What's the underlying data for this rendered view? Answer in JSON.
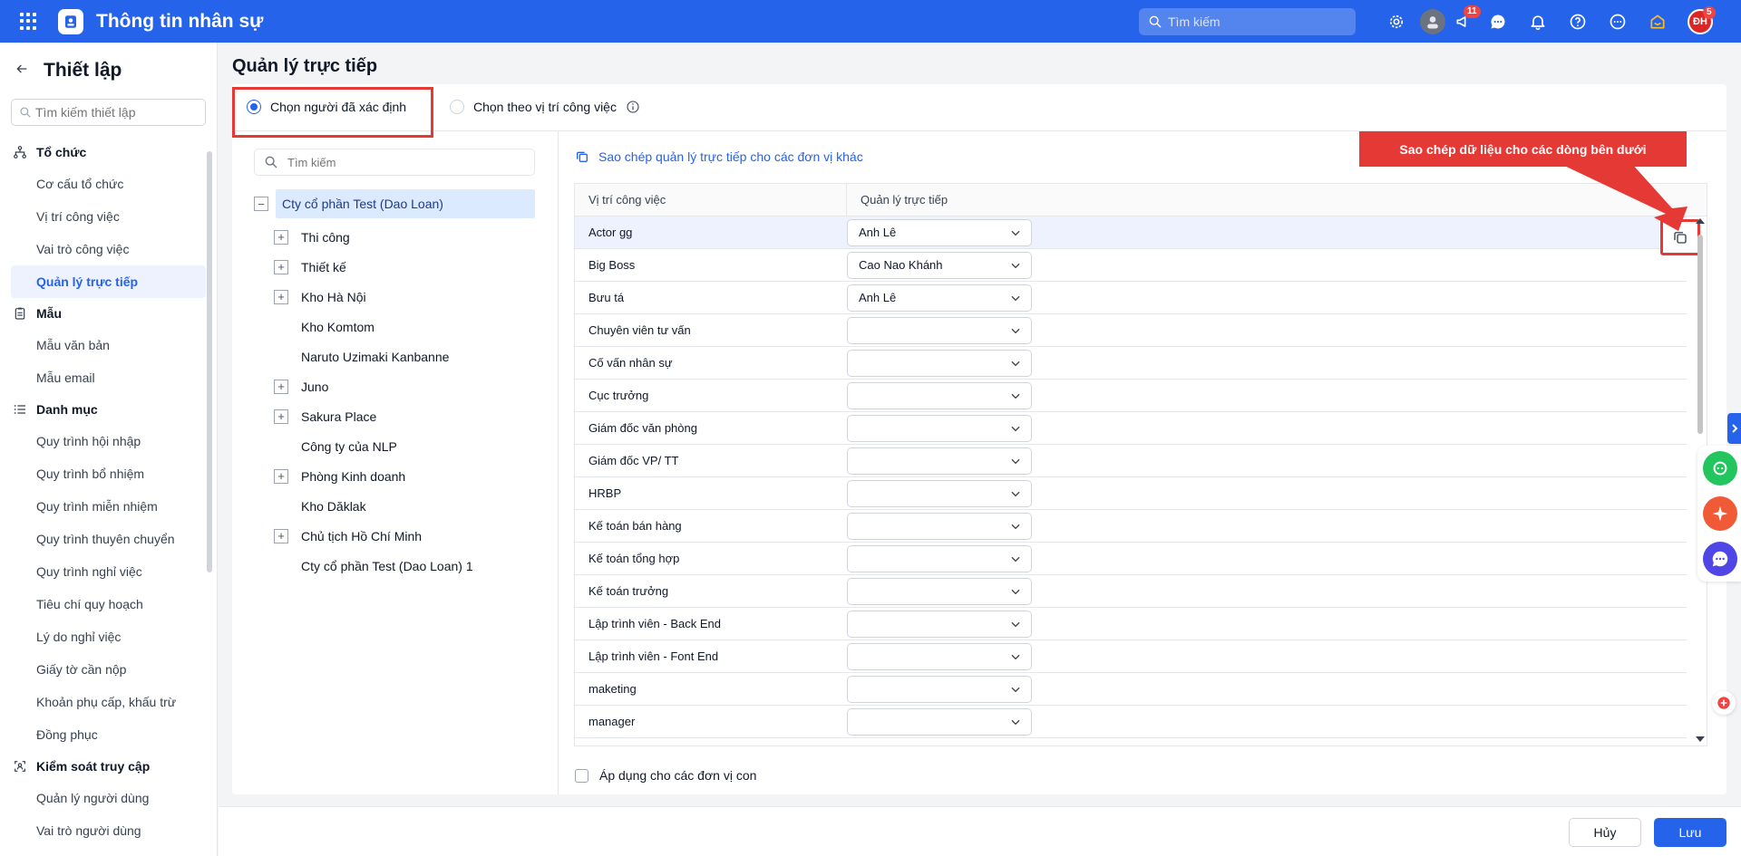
{
  "header": {
    "app_title": "Thông tin nhân sự",
    "search_placeholder": "Tìm kiếm",
    "notification_badge": "11",
    "avatar_initials": "ĐH",
    "avatar_badge": "5",
    "colors": {
      "primary": "#2563eb",
      "danger": "#e53935"
    }
  },
  "sidebar": {
    "title": "Thiết lập",
    "search_placeholder": "Tìm kiếm thiết lập",
    "groups": [
      {
        "label": "Tổ chức",
        "icon": "org-icon",
        "items": [
          "Cơ cấu tổ chức",
          "Vị trí công việc",
          "Vai trò công việc",
          "Quản lý trực tiếp"
        ]
      },
      {
        "label": "Mẫu",
        "icon": "clipboard-icon",
        "items": [
          "Mẫu văn bản",
          "Mẫu email"
        ]
      },
      {
        "label": "Danh mục",
        "icon": "list-icon",
        "items": [
          "Quy trình hội nhập",
          "Quy trình bổ nhiệm",
          "Quy trình miễn nhiệm",
          "Quy trình thuyên chuyển",
          "Quy trình nghỉ việc",
          "Tiêu chí quy hoạch",
          "Lý do nghỉ việc",
          "Giấy tờ cần nộp",
          "Khoản phụ cấp, khấu trừ",
          "Đồng phục"
        ]
      },
      {
        "label": "Kiểm soát truy cập",
        "icon": "access-icon",
        "items": [
          "Quản lý người dùng",
          "Vai trò người dùng"
        ]
      }
    ],
    "active_item": "Quản lý trực tiếp"
  },
  "main": {
    "page_title": "Quản lý trực tiếp",
    "mode_options": [
      "Chọn người đã xác định",
      "Chọn theo vị trí công việc"
    ],
    "selected_mode": 0,
    "tree": {
      "search_placeholder": "Tìm kiếm",
      "root": "Cty cổ phần Test (Dao Loan)",
      "nodes": [
        {
          "label": "Thi công",
          "expandable": true
        },
        {
          "label": "Thiết kế",
          "expandable": true
        },
        {
          "label": "Kho Hà Nội",
          "expandable": true
        },
        {
          "label": "Kho Komtom",
          "expandable": false
        },
        {
          "label": "Naruto Uzimaki Kanbanne",
          "expandable": false
        },
        {
          "label": "Juno",
          "expandable": true
        },
        {
          "label": "Sakura Place",
          "expandable": true
        },
        {
          "label": "Công ty của NLP",
          "expandable": false
        },
        {
          "label": "Phòng Kinh doanh",
          "expandable": true
        },
        {
          "label": "Kho Dăklak",
          "expandable": false
        },
        {
          "label": "Chủ tịch Hồ Chí Minh",
          "expandable": true
        },
        {
          "label": "Cty cổ phần Test (Dao Loan) 1",
          "expandable": false
        }
      ]
    },
    "copy_link": "Sao chép quản lý trực tiếp cho các đơn vị khác",
    "table": {
      "col_position": "Vị trí công việc",
      "col_manager": "Quản lý trực tiếp",
      "rows": [
        {
          "position": "Actor gg",
          "manager": "Anh Lê"
        },
        {
          "position": "Big Boss",
          "manager": "Cao Nao Khánh"
        },
        {
          "position": "Bưu tá",
          "manager": "Anh Lê"
        },
        {
          "position": "Chuyên viên tư vấn",
          "manager": ""
        },
        {
          "position": "Cố vấn nhân sự",
          "manager": ""
        },
        {
          "position": "Cục trưởng",
          "manager": ""
        },
        {
          "position": "Giám đốc văn phòng",
          "manager": ""
        },
        {
          "position": "Giám đốc VP/ TT",
          "manager": ""
        },
        {
          "position": "HRBP",
          "manager": ""
        },
        {
          "position": "Kế toán bán hàng",
          "manager": ""
        },
        {
          "position": "Kế toán tổng hợp",
          "manager": ""
        },
        {
          "position": "Kế toán trưởng",
          "manager": ""
        },
        {
          "position": "Lập trình viên - Back End",
          "manager": ""
        },
        {
          "position": "Lập trình viên - Font End",
          "manager": ""
        },
        {
          "position": "maketing",
          "manager": ""
        },
        {
          "position": "manager",
          "manager": ""
        }
      ]
    },
    "apply_children_label": "Áp dụng cho các đơn vị con",
    "tooltip": "Sao chép dữ liệu cho các dòng bên dưới"
  },
  "footer": {
    "cancel_label": "Hủy",
    "save_label": "Lưu"
  }
}
